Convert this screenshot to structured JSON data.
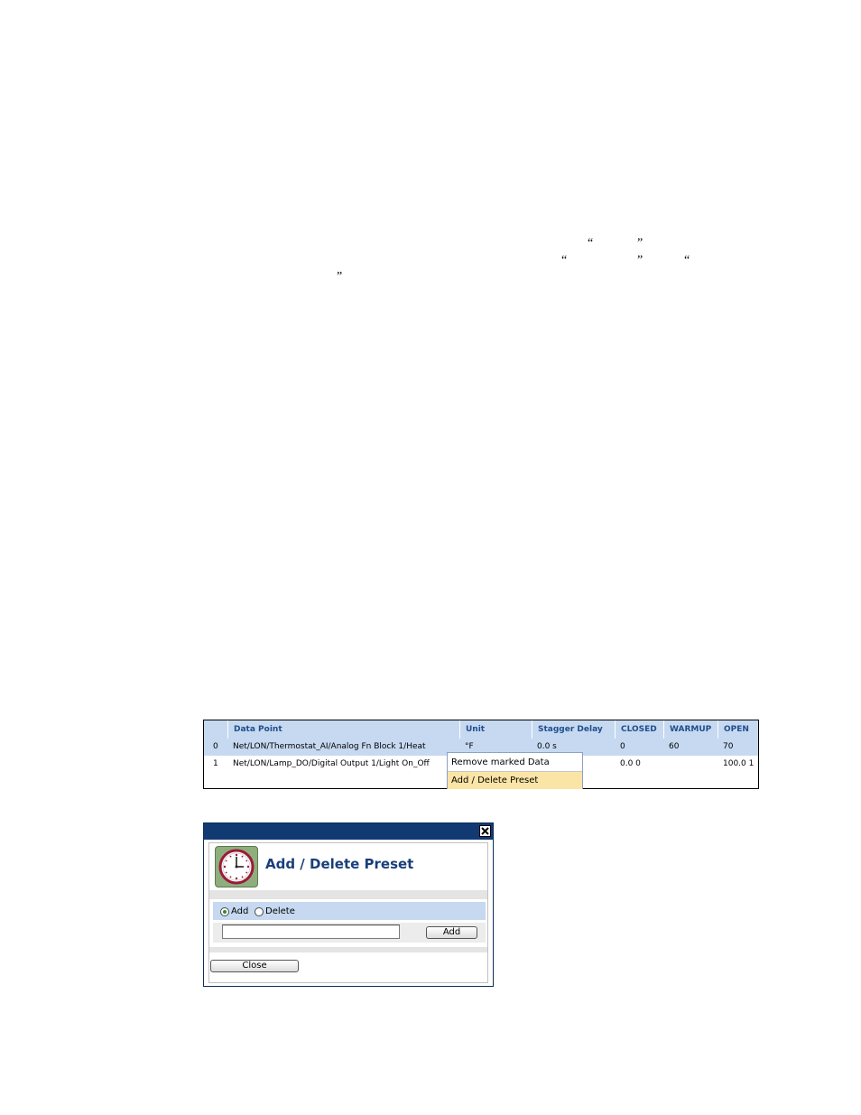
{
  "document": {
    "quote_marks": [
      "“",
      "”",
      "“",
      "”",
      "“",
      "”"
    ]
  },
  "data_point_table": {
    "columns": [
      "",
      "Data Point",
      "Unit",
      "Stagger Delay",
      "CLOSED",
      "WARMUP",
      "OPEN"
    ],
    "rows": [
      {
        "index": "0",
        "data_point": "Net/LON/Thermostat_AI/Analog Fn Block 1/Heat",
        "unit": "°F",
        "stagger_delay": "0.0 s",
        "closed": "0",
        "warmup": "60",
        "open": "70"
      },
      {
        "index": "1",
        "data_point": "Net/LON/Lamp_DO/Digital Output 1/Light On_Off",
        "unit": "",
        "stagger_delay": "",
        "closed": "0.0 0",
        "warmup": "",
        "open": "100.0 1"
      }
    ]
  },
  "context_menu": {
    "items": [
      "Remove marked Data Point(s)",
      "Add / Delete Preset"
    ],
    "highlighted": "Add / Delete Preset"
  },
  "preset_dialog": {
    "title": "Add / Delete Preset",
    "radio_add_label": "Add",
    "radio_delete_label": "Delete",
    "selected_mode": "Add",
    "name_input_value": "",
    "add_button_label": "Add",
    "close_button_label": "Close",
    "icon": "clock-icon"
  },
  "colors": {
    "header_bg": "#c6d9f1",
    "header_text": "#1f4e8c",
    "dialog_titlebar": "#123a72",
    "dialog_title_text": "#1a3f7a",
    "menu_highlight": "#fbe5a6"
  }
}
